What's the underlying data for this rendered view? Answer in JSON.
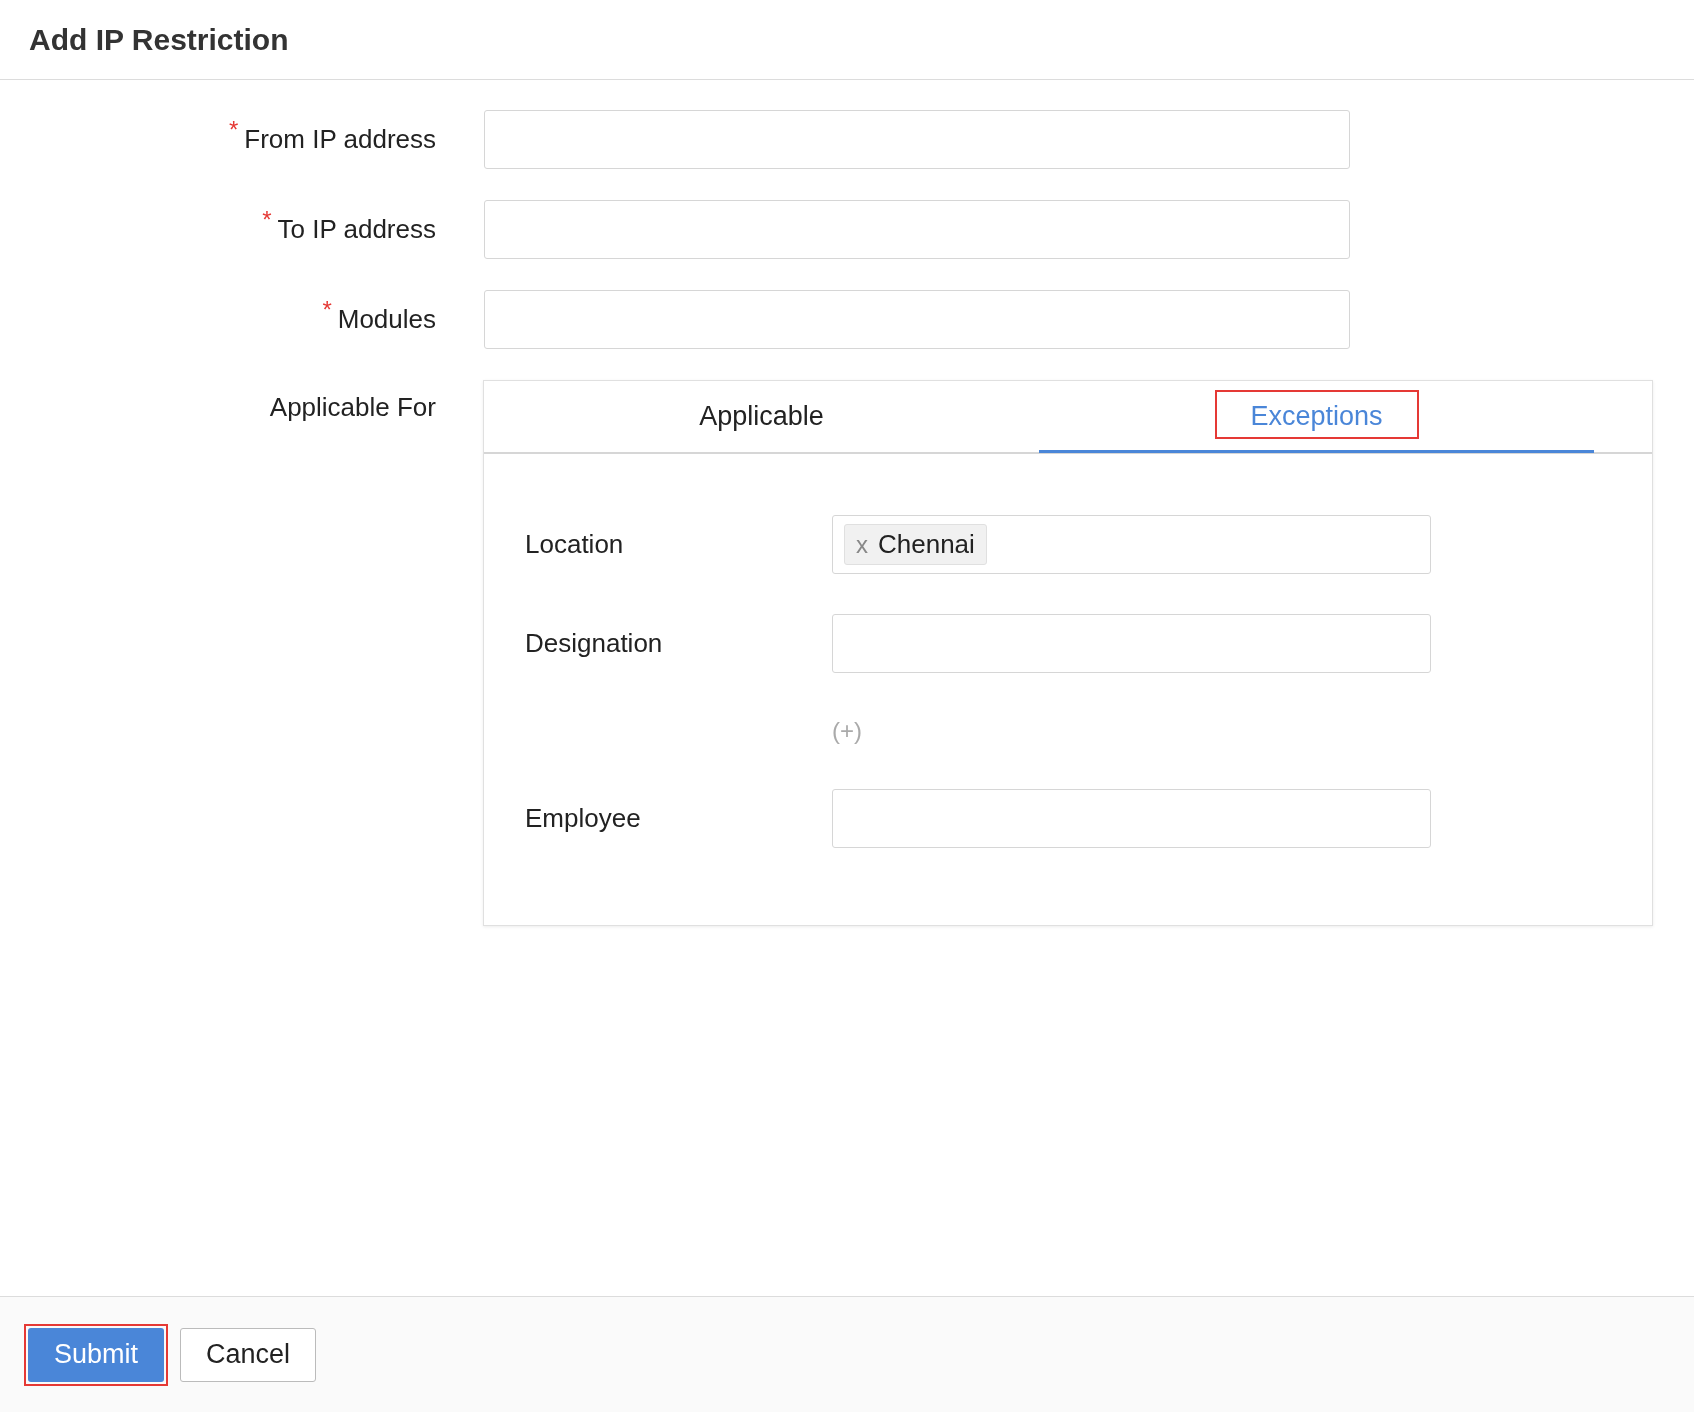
{
  "title": "Add IP Restriction",
  "fields": [
    {
      "label": "From IP address",
      "required": true
    },
    {
      "label": "To IP address",
      "required": true
    },
    {
      "label": "Modules",
      "required": true
    }
  ],
  "required_mark": "*",
  "applicable_for": {
    "label": "Applicable For",
    "tabs": [
      {
        "label": "Applicable",
        "selected": false,
        "highlighted": false
      },
      {
        "label": "Exceptions",
        "selected": true,
        "highlighted": true
      }
    ],
    "rows": [
      {
        "kind": "field",
        "label": "Location",
        "chips": [
          {
            "remove": "x",
            "label": "Chennai"
          }
        ]
      },
      {
        "kind": "field",
        "label": "Designation",
        "chips": []
      },
      {
        "kind": "add",
        "label": "(+)"
      },
      {
        "kind": "field",
        "label": "Employee",
        "chips": []
      }
    ]
  },
  "buttons": [
    {
      "label": "Submit",
      "kind": "primary",
      "highlighted": true
    },
    {
      "label": "Cancel",
      "kind": "secondary",
      "highlighted": false
    }
  ]
}
